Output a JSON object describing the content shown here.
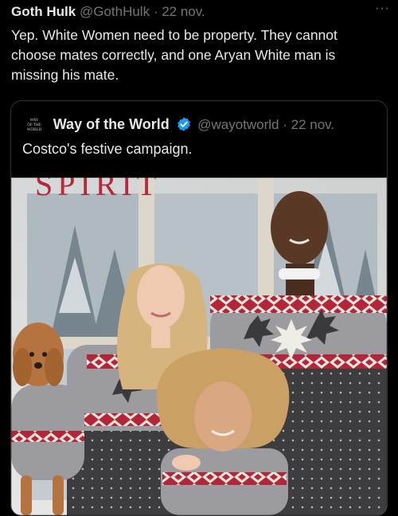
{
  "post": {
    "author_name": "Goth Hulk",
    "handle": "@GothHulk",
    "separator": "·",
    "time": "22 nov.",
    "more_label": "···",
    "text": "Yep. White Women need to be property. They cannot choose mates correctly, and one Aryan White man is missing his mate."
  },
  "quote": {
    "logo_text": [
      "WAY",
      "OF THE",
      "WORLD"
    ],
    "author_name": "Way of the World",
    "verified_icon": "verified-badge-icon",
    "handle": "@wayotworld",
    "separator": "·",
    "time": "22 nov.",
    "text": "Costco's festive campaign.",
    "photo": {
      "banner_text": "SPIRIT",
      "description_icons": [
        "dog",
        "woman",
        "child",
        "man"
      ]
    }
  },
  "colors": {
    "background": "#000000",
    "text": "#e7e9ea",
    "muted": "#71767b",
    "border": "#2f3336",
    "verified": "#1d9bf0",
    "sweater_grey": "#9a9a9c",
    "sweater_red": "#b3263a"
  }
}
